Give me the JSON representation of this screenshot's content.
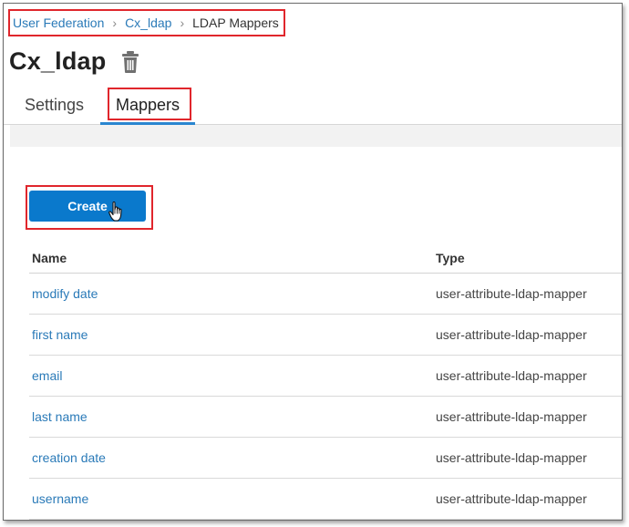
{
  "breadcrumb": {
    "items": [
      "User Federation",
      "Cx_ldap"
    ],
    "current": "LDAP Mappers"
  },
  "page": {
    "title": "Cx_ldap"
  },
  "tabs": [
    {
      "label": "Settings"
    },
    {
      "label": "Mappers"
    }
  ],
  "actions": {
    "create_label": "Create"
  },
  "table": {
    "columns": [
      "Name",
      "Type"
    ],
    "rows": [
      {
        "name": "modify date",
        "type": "user-attribute-ldap-mapper"
      },
      {
        "name": "first name",
        "type": "user-attribute-ldap-mapper"
      },
      {
        "name": "email",
        "type": "user-attribute-ldap-mapper"
      },
      {
        "name": "last name",
        "type": "user-attribute-ldap-mapper"
      },
      {
        "name": "creation date",
        "type": "user-attribute-ldap-mapper"
      },
      {
        "name": "username",
        "type": "user-attribute-ldap-mapper"
      }
    ]
  },
  "colors": {
    "link": "#2a7ab8",
    "primary": "#0a79cc",
    "highlight": "#e0262c"
  },
  "icons": {
    "delete": "trash-icon",
    "cursor": "hand-pointer-icon"
  }
}
